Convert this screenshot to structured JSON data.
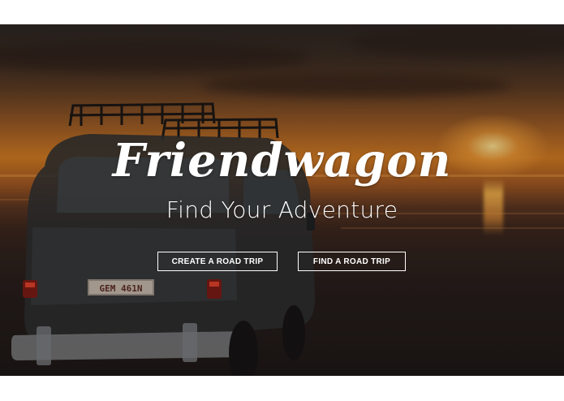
{
  "hero": {
    "title": "Friendwagon",
    "tagline": "Find Your Adventure",
    "plate": "GEM 461N"
  },
  "actions": {
    "create_label": "CREATE A ROAD TRIP",
    "find_label": "FIND A ROAD TRIP"
  },
  "colors": {
    "overlay_text": "#ffffff",
    "sun": "#ffd98a",
    "sky_dark": "#2b2522",
    "sunset_orange": "#d07a22"
  }
}
